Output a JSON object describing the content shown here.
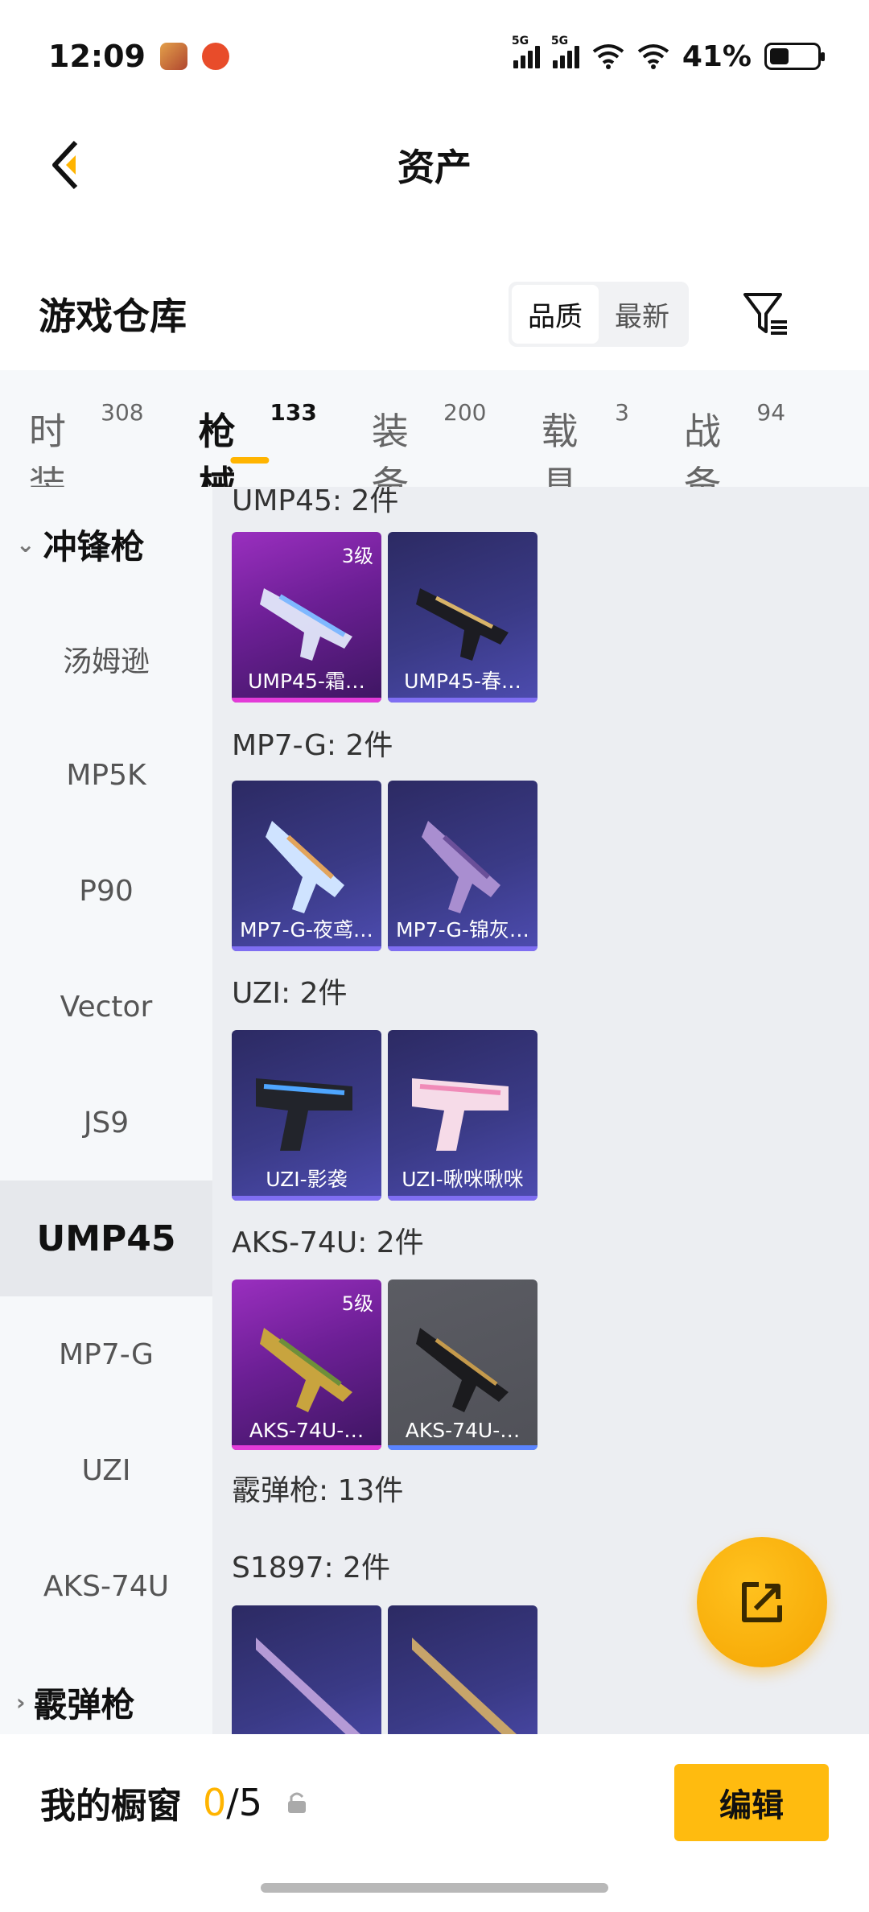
{
  "status": {
    "time": "12:09",
    "battery": "41%",
    "sig1": "5G",
    "sig2": "5G",
    "battery_level": 0.41
  },
  "header": {
    "title": "资产"
  },
  "warehouse": {
    "title": "游戏仓库",
    "sort_quality": "品质",
    "sort_latest": "最新"
  },
  "tabs": [
    {
      "label": "时装",
      "count": "308"
    },
    {
      "label": "枪械",
      "count": "133"
    },
    {
      "label": "装备",
      "count": "200"
    },
    {
      "label": "载具",
      "count": "3"
    },
    {
      "label": "战备",
      "count": "94"
    }
  ],
  "sidebar": {
    "cat_smg": "冲锋枪",
    "items": [
      "汤姆逊",
      "MP5K",
      "P90",
      "Vector",
      "JS9",
      "UMP45",
      "MP7-G",
      "UZI",
      "AKS-74U"
    ],
    "cat_shotgun": "霰弹枪"
  },
  "content": {
    "g_ump45": "UMP45: 2件",
    "g_mp7": "MP7-G: 2件",
    "g_uzi": "UZI: 2件",
    "g_aks": "AKS-74U: 2件",
    "g_shotgun": "霰弹枪: 13件",
    "g_s1897": "S1897: 2件",
    "cards": {
      "ump1": {
        "name": "UMP45-霜…",
        "level": "3级"
      },
      "ump2": {
        "name": "UMP45-春…"
      },
      "mp71": {
        "name": "MP7-G-夜鸢…"
      },
      "mp72": {
        "name": "MP7-G-锦灰…"
      },
      "uzi1": {
        "name": "UZI-影袭"
      },
      "uzi2": {
        "name": "UZI-啾咪啾咪"
      },
      "aks1": {
        "name": "AKS-74U-…",
        "level": "5级"
      },
      "aks2": {
        "name": "AKS-74U-…"
      }
    }
  },
  "bottom": {
    "label": "我的橱窗",
    "count": "0",
    "sep": "/",
    "total": "5",
    "edit": "编辑"
  },
  "colors": {
    "accent": "#ffb400",
    "legendary": "#e33bd8",
    "epic": "#7f6ef2"
  },
  "icons": [
    "back-arrow-icon",
    "filter-icon",
    "share-icon",
    "lock-icon",
    "chevron-down-icon",
    "chevron-right-icon",
    "wifi-icon",
    "signal-icon",
    "battery-icon"
  ]
}
